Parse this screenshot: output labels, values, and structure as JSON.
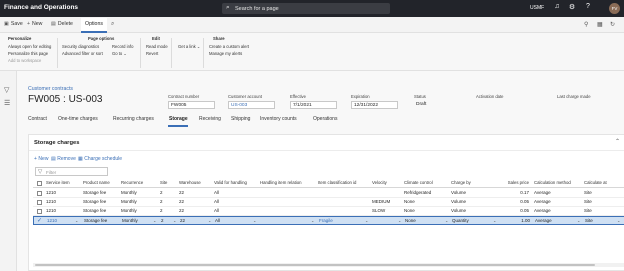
{
  "app": {
    "title": "Finance and Operations",
    "search_placeholder": "Search for a page",
    "company": "USMF",
    "avatar_initials": "FV"
  },
  "actions": {
    "save": "Save",
    "new": "New",
    "delete": "Delete",
    "options": "Options"
  },
  "ribbon": {
    "personalize": {
      "title": "Personalize",
      "items": [
        "Always open for editing",
        "Personalize this page",
        "Add to workspace"
      ]
    },
    "page_options": {
      "title": "Page options",
      "col1": [
        "Security diagnostics",
        "Advanced filter or sort"
      ],
      "col2": [
        "Record info",
        "Go to"
      ]
    },
    "edit": {
      "title": "Edit",
      "items": [
        "Read mode",
        "Revert"
      ]
    },
    "get_link": "Get a link",
    "share": {
      "title": "Share",
      "items": [
        "Create a custom alert",
        "Manage my alerts"
      ]
    }
  },
  "header": {
    "breadcrumb": "Customer contracts",
    "title": "FW005 : US-003",
    "fields": [
      {
        "label": "Contract number",
        "value": "FW005"
      },
      {
        "label": "Customer account",
        "value": "US-003"
      },
      {
        "label": "Effective",
        "value": "7/1/2021"
      },
      {
        "label": "Expiration",
        "value": "12/31/2022"
      },
      {
        "label": "Status",
        "value": "Draft"
      },
      {
        "label": "Activation date",
        "value": ""
      },
      {
        "label": "Last charge made",
        "value": ""
      }
    ]
  },
  "tabs": [
    "Contract",
    "One-time charges",
    "Recurring charges",
    "Storage",
    "Receiving",
    "Shipping",
    "Inventory counts",
    "Operations"
  ],
  "section": {
    "title": "Storage charges",
    "new": "New",
    "remove": "Remove",
    "charge_schedule": "Charge schedule",
    "filter_placeholder": "Filter"
  },
  "grid": {
    "columns": [
      "Service item",
      "Product name",
      "Recurrence",
      "Site",
      "Warehouse",
      "Valid for handling",
      "Handling item relation",
      "Item classification id",
      "Velocity",
      "Climate control",
      "Charge by",
      "Sales price",
      "Calculation method",
      "Calculate at"
    ],
    "rows": [
      [
        "1210",
        "Storage fee",
        "Monthly",
        "2",
        "22",
        "All",
        "",
        "",
        "",
        "Refridgerated",
        "Volume",
        "0.17",
        "Average",
        "Site"
      ],
      [
        "1210",
        "Storage fee",
        "Monthly",
        "2",
        "22",
        "All",
        "",
        "",
        "MEDIUM",
        "None",
        "Volume",
        "0.05",
        "Average",
        "Site"
      ],
      [
        "1210",
        "Storage fee",
        "Monthly",
        "2",
        "22",
        "All",
        "",
        "",
        "SLOW",
        "None",
        "Volume",
        "0.05",
        "Average",
        "Site"
      ],
      [
        "1210",
        "Storage fee",
        "Monthly",
        "2",
        "22",
        "All",
        "",
        "Fragile",
        "",
        "None",
        "Quantity",
        "1.00",
        "Average",
        "Site"
      ]
    ]
  }
}
